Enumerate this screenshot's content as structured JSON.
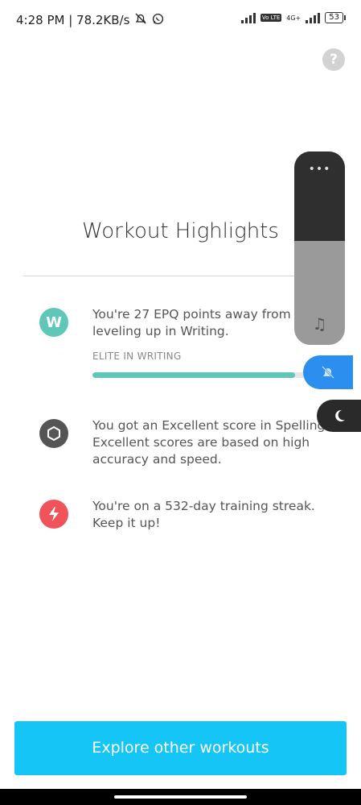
{
  "status_bar": {
    "time_speed": "4:28 PM | 78.2KB/s",
    "network_label": "4G+",
    "volte_label": "Vo LTE",
    "battery": "53"
  },
  "help_icon": "?",
  "title": "Workout Highlights",
  "highlights": [
    {
      "badge_letter": "W",
      "badge_color": "#5ec7b7",
      "text": "You're 27 EPQ points away from leveling up in Writing.",
      "sub_label": "ELITE IN WRITING",
      "progress": 0.92
    },
    {
      "badge_color": "#555555",
      "text": "You got an Excellent score in Spelling. Excellent scores are based on high accuracy and speed."
    },
    {
      "badge_color": "#f0545a",
      "text": "You're on a 532-day training streak. Keep it up!"
    }
  ],
  "cta": {
    "label": "Explore other workouts",
    "color": "#15c5f5"
  },
  "volume_panel": {
    "more": "•••",
    "icons": [
      "music-note-icon",
      "bell-off-icon",
      "moon-icon"
    ]
  }
}
